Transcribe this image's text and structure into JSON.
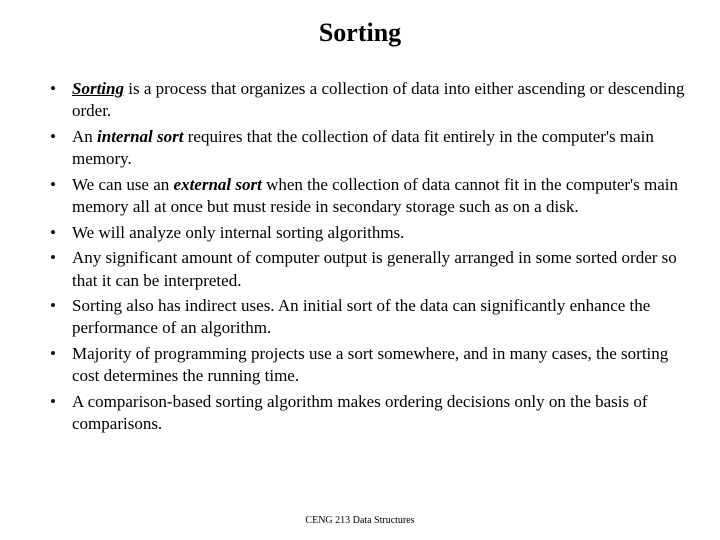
{
  "title": "Sorting",
  "bullets": [
    {
      "parts": [
        {
          "text": "Sorting",
          "cls": "bi u"
        },
        {
          "text": " is a process that organizes a collection of data into either ascending or descending order."
        }
      ]
    },
    {
      "parts": [
        {
          "text": "An "
        },
        {
          "text": "internal sort",
          "cls": "bi"
        },
        {
          "text": " requires that the collection of data fit entirely in the computer's main memory."
        }
      ]
    },
    {
      "parts": [
        {
          "text": "We can use an "
        },
        {
          "text": "external sort",
          "cls": "bi"
        },
        {
          "text": "  when  the collection of data cannot fit in the computer's main memory all at once but must reside in secondary storage such as on a disk."
        }
      ]
    },
    {
      "parts": [
        {
          "text": "We will analyze only internal sorting algorithms."
        }
      ]
    },
    {
      "parts": [
        {
          "text": "Any significant amount of computer output is generally arranged in some sorted order so that it can be interpreted."
        }
      ]
    },
    {
      "parts": [
        {
          "text": "Sorting also has indirect uses. An initial sort of the data can significantly enhance the performance of an algorithm."
        }
      ]
    },
    {
      "parts": [
        {
          "text": "Majority of programming projects use a sort somewhere, and in many cases, the sorting cost determines the running time."
        }
      ]
    },
    {
      "parts": [
        {
          "text": "A comparison-based sorting algorithm makes ordering decisions only on the basis of comparisons."
        }
      ]
    }
  ],
  "footer": "CENG 213 Data Structures"
}
